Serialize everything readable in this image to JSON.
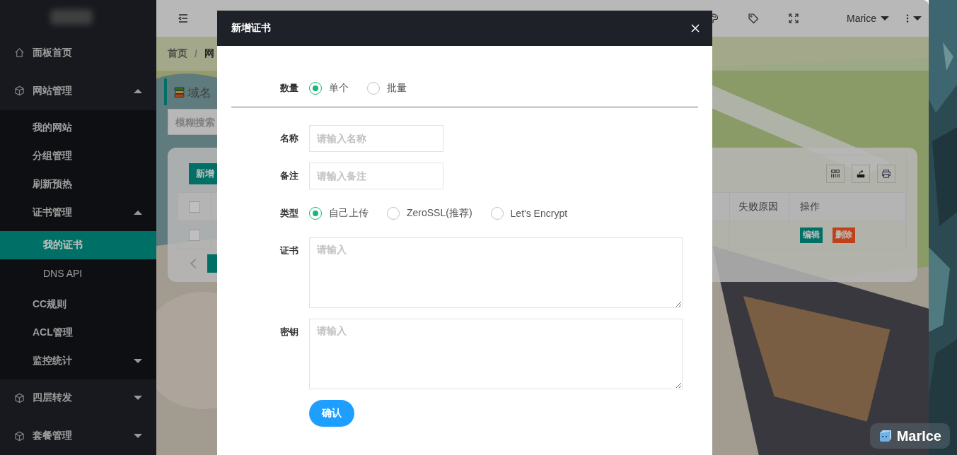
{
  "sidebar": {
    "items": [
      {
        "label": "面板首页",
        "selected": false
      },
      {
        "label": "网站管理",
        "selected": false,
        "expanded": true,
        "children": [
          {
            "label": "我的网站",
            "selected": false
          },
          {
            "label": "分组管理",
            "selected": false
          },
          {
            "label": "刷新预热",
            "selected": false
          },
          {
            "label": "证书管理",
            "selected": false,
            "expanded": true,
            "children": [
              {
                "label": "我的证书",
                "selected": true
              },
              {
                "label": "DNS API",
                "selected": false
              }
            ]
          },
          {
            "label": "CC规则",
            "selected": false
          },
          {
            "label": "ACL管理",
            "selected": false
          },
          {
            "label": "监控统计",
            "selected": false,
            "expanded": false
          }
        ]
      },
      {
        "label": "四层转发",
        "selected": false,
        "expanded": false
      },
      {
        "label": "套餐管理",
        "selected": false,
        "expanded": false
      }
    ]
  },
  "header": {
    "user": "Marice"
  },
  "breadcrumb": {
    "items": [
      "首页",
      "网"
    ],
    "separator": "/"
  },
  "page": {
    "title": "域名",
    "search": {
      "placeholder": "模糊搜索"
    },
    "add_button": "新增",
    "table": {
      "columns": [
        "失败原因",
        "操作"
      ],
      "header_checked": false,
      "rows": [
        {
          "checked": false,
          "actions": [
            "编辑",
            "删除"
          ]
        }
      ]
    }
  },
  "modal": {
    "title": "新增证书",
    "fields": [
      {
        "kind": "radio",
        "label": "数量",
        "divider_after": true,
        "options": [
          {
            "label": "单个",
            "selected": true
          },
          {
            "label": "批量",
            "selected": false
          }
        ]
      },
      {
        "kind": "input",
        "label": "名称",
        "placeholder": "请输入名称"
      },
      {
        "kind": "input",
        "label": "备注",
        "placeholder": "请输入备注"
      },
      {
        "kind": "radio",
        "label": "类型",
        "options": [
          {
            "label": "自己上传",
            "selected": true
          },
          {
            "label": "ZeroSSL(推荐)",
            "selected": false
          },
          {
            "label": "Let's Encrypt",
            "selected": false
          }
        ]
      },
      {
        "kind": "textarea",
        "label": "证书",
        "placeholder": "请输入"
      },
      {
        "kind": "textarea",
        "label": "密钥",
        "placeholder": "请输入"
      }
    ],
    "submit": "确认"
  },
  "badge": {
    "text": "MarIce"
  }
}
